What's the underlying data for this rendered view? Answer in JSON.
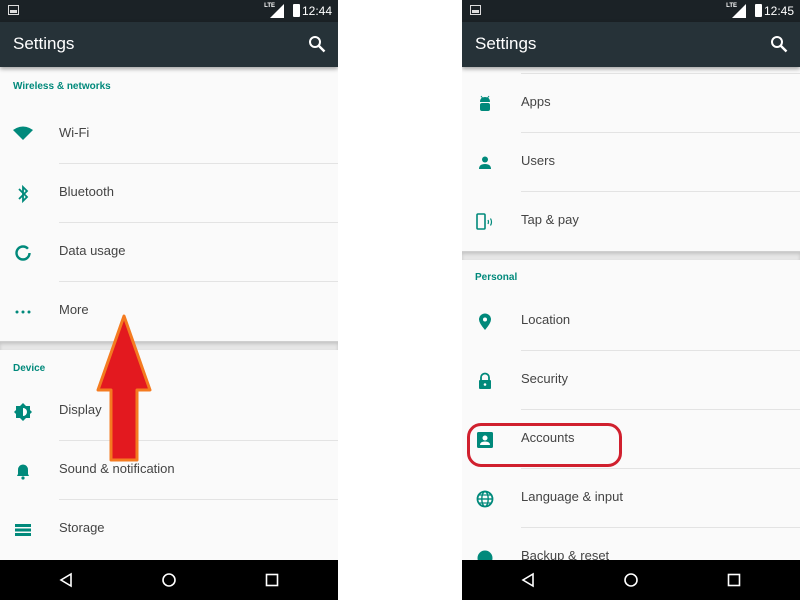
{
  "left_screen": {
    "status_bar": {
      "network": "LTE",
      "time": "12:44"
    },
    "app_bar": {
      "title": "Settings",
      "search_icon": "search-icon"
    },
    "sections": [
      {
        "header": "Wireless & networks",
        "items": [
          {
            "label": "Wi-Fi",
            "icon": "wifi-icon"
          },
          {
            "label": "Bluetooth",
            "icon": "bluetooth-icon"
          },
          {
            "label": "Data usage",
            "icon": "data-usage-icon"
          },
          {
            "label": "More",
            "icon": "more-icon"
          }
        ]
      },
      {
        "header": "Device",
        "items": [
          {
            "label": "Display",
            "icon": "display-icon"
          },
          {
            "label": "Sound & notification",
            "icon": "bell-icon"
          },
          {
            "label": "Storage",
            "icon": "storage-icon"
          }
        ]
      }
    ],
    "annotation": "up-arrow"
  },
  "right_screen": {
    "status_bar": {
      "network": "LTE",
      "time": "12:45"
    },
    "app_bar": {
      "title": "Settings",
      "search_icon": "search-icon"
    },
    "sections": [
      {
        "header": "",
        "items": [
          {
            "label": "Apps",
            "icon": "android-icon"
          },
          {
            "label": "Users",
            "icon": "person-icon"
          },
          {
            "label": "Tap & pay",
            "icon": "tap-pay-icon"
          }
        ]
      },
      {
        "header": "Personal",
        "items": [
          {
            "label": "Location",
            "icon": "location-icon"
          },
          {
            "label": "Security",
            "icon": "lock-icon"
          },
          {
            "label": "Accounts",
            "icon": "account-box-icon",
            "highlighted": true
          },
          {
            "label": "Language & input",
            "icon": "globe-icon"
          },
          {
            "label": "Backup & reset",
            "icon": "backup-icon"
          }
        ]
      }
    ],
    "annotation": "highlight-circle"
  },
  "colors": {
    "accent": "#00897b",
    "app_bar": "#263238",
    "status_bar": "#1b2226",
    "annotation_red": "#e3191f",
    "annotation_orange": "#f47b20"
  }
}
